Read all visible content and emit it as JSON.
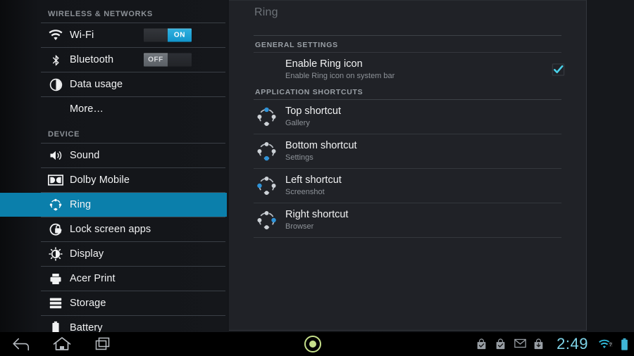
{
  "sidebar": {
    "sections": [
      {
        "header": "WIRELESS & NETWORKS",
        "items": [
          {
            "label": "Wi-Fi",
            "icon": "wifi-icon",
            "toggle": "ON",
            "toggle_state": "on"
          },
          {
            "label": "Bluetooth",
            "icon": "bluetooth-icon",
            "toggle": "OFF",
            "toggle_state": "off"
          },
          {
            "label": "Data usage",
            "icon": "data-usage-icon"
          },
          {
            "label": "More…",
            "icon": "none"
          }
        ]
      },
      {
        "header": "DEVICE",
        "items": [
          {
            "label": "Sound",
            "icon": "speaker-icon"
          },
          {
            "label": "Dolby Mobile",
            "icon": "dolby-icon"
          },
          {
            "label": "Ring",
            "icon": "ring-icon",
            "selected": true
          },
          {
            "label": "Lock screen apps",
            "icon": "lock-icon"
          },
          {
            "label": "Display",
            "icon": "brightness-icon"
          },
          {
            "label": "Acer Print",
            "icon": "printer-icon"
          },
          {
            "label": "Storage",
            "icon": "storage-icon"
          },
          {
            "label": "Battery",
            "icon": "battery-icon"
          }
        ]
      }
    ]
  },
  "panel": {
    "title": "Ring",
    "general_section": {
      "header": "GENERAL SETTINGS",
      "pref": {
        "title": "Enable Ring icon",
        "subtitle": "Enable Ring icon on system bar",
        "checked": true
      }
    },
    "shortcuts_section": {
      "header": "APPLICATION SHORTCUTS",
      "items": [
        {
          "title": "Top shortcut",
          "value": "Gallery",
          "icon": "ring-position-top-icon",
          "position": "top"
        },
        {
          "title": "Bottom shortcut",
          "value": "Settings",
          "icon": "ring-position-bottom-icon",
          "position": "bottom"
        },
        {
          "title": "Left shortcut",
          "value": "Screenshot",
          "icon": "ring-position-left-icon",
          "position": "left"
        },
        {
          "title": "Right shortcut",
          "value": "Browser",
          "icon": "ring-position-right-icon",
          "position": "right"
        }
      ]
    }
  },
  "system_bar": {
    "nav": [
      {
        "name": "back-icon",
        "label": "Back"
      },
      {
        "name": "home-icon",
        "label": "Home"
      },
      {
        "name": "recents-icon",
        "label": "Recent apps"
      }
    ],
    "ring_launcher": "ring-launcher-icon",
    "status_icons": [
      "play-store-download-complete-icon",
      "play-store-download-complete-icon",
      "gmail-icon",
      "download-icon"
    ],
    "clock": "2:49",
    "wifi": "wifi-status-icon",
    "battery": "battery-status-icon"
  },
  "colors": {
    "accent_selected": "#0b7fab",
    "toggle_on": "#1195cc",
    "checkbox": "#4ad0e8",
    "clock_text": "#7fd4e8",
    "ring_dot_active": "#2f93d8",
    "launcher_green": "#c6e08a"
  }
}
